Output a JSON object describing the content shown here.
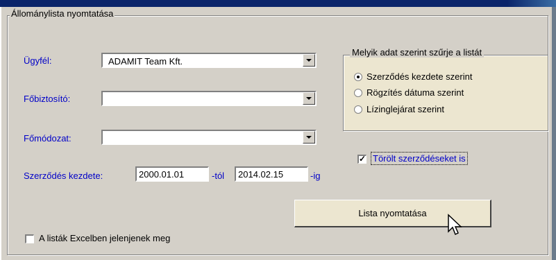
{
  "group_title": "Állománylista nyomtatása",
  "fields": {
    "client_label": "Ügyfél:",
    "client_value": "ADAMIT Team Kft.",
    "insurer_label": "Főbiztosító:",
    "insurer_value": "",
    "mode_label": "Főmódozat:",
    "mode_value": "",
    "contract_start_label": "Szerződés kezdete:",
    "date_from": "2000.01.01",
    "from_suffix": "-tól",
    "date_to": "2014.02.15",
    "to_suffix": "-ig"
  },
  "filter": {
    "title": "Melyik adat szerint szűrje a listát",
    "options": [
      {
        "label": "Szerződés kezdete szerint",
        "selected": true
      },
      {
        "label": "Rögzítés dátuma szerint",
        "selected": false
      },
      {
        "label": "Lízinglejárat szerint",
        "selected": false
      }
    ]
  },
  "deleted_checkbox": {
    "label": "Törölt szerződéseket is",
    "checked": true
  },
  "excel_checkbox": {
    "label": "A listák Excelben jelenjenek meg",
    "checked": false
  },
  "print_button": {
    "label": "Lista nyomtatása"
  }
}
